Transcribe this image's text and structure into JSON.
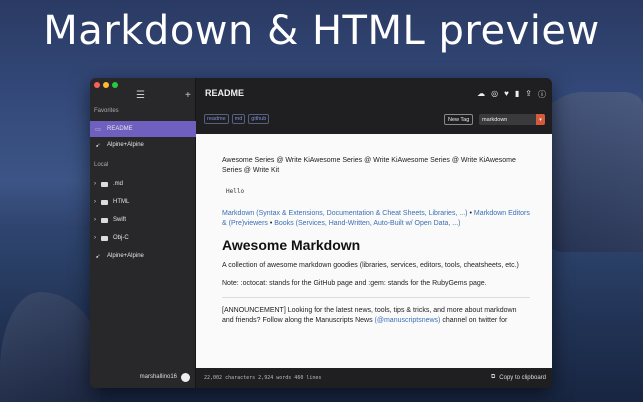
{
  "hero": {
    "title": "Markdown & HTML preview"
  },
  "colors": {
    "accent": "#6f5fbf",
    "link": "#3a6fb5",
    "select_arrow": "#d35a3b"
  },
  "sidebar": {
    "favorites_label": "Favorites",
    "local_label": "Local",
    "favorites": [
      {
        "label": "README",
        "icon": "md-icon",
        "selected": true
      },
      {
        "label": "Alpine+Alpine",
        "icon": "swift-bird-icon"
      }
    ],
    "local": [
      {
        "label": ".md",
        "icon": "folder-icon"
      },
      {
        "label": "HTML",
        "icon": "folder-icon"
      },
      {
        "label": "Swift",
        "icon": "folder-icon"
      },
      {
        "label": "Obj-C",
        "icon": "folder-icon"
      },
      {
        "label": "Alpine+Alpine",
        "icon": "swift-bird-icon"
      }
    ],
    "user": "marshallino16"
  },
  "doc": {
    "title": "README",
    "tags": [
      "readme",
      "md",
      "github"
    ],
    "new_tag_label": "New Tag",
    "tag_select_value": "markdown"
  },
  "preview": {
    "para1": "Awesome Series @ Write KiAwesome Series @ Write KiAwesome Series @ Write KiAwesome Series @ Write Kit",
    "code": "Hello",
    "links_line1": "Markdown (Syntax & Extensions, Documentation & Cheat Sheets, Libraries, ...)",
    "bullet1": " • ",
    "links_line2": "Markdown Editors & (Pre)viewers",
    "bullet2": " • ",
    "links_line3": "Books (Services, Hand-Written, Auto-Built w/ Open Data, ...)",
    "heading": "Awesome Markdown",
    "para2": "A collection of awesome markdown goodies (libraries, services, editors, tools, cheatsheets, etc.)",
    "para3": "Note: :octocat: stands for the GitHub page and :gem: stands for the RubyGems page.",
    "para4a": "[ANNOUNCEMENT] Looking for the latest news, tools, tips & tricks, and more about markdown and friends? Follow along the Manuscripts News ",
    "para4link": "(@manuscriptsnews)",
    "para4b": " channel on twitter for"
  },
  "status": {
    "stats": "22,002 characters 2,924 words 460 lines",
    "copy_label": "Copy to clipboard"
  }
}
